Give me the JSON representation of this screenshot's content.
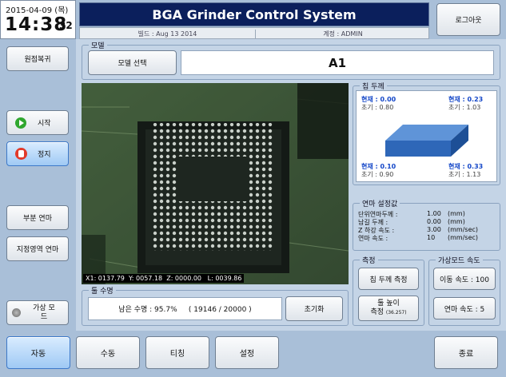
{
  "datetime": {
    "date": "2015-04-09 (목)",
    "time": "14:38",
    "seconds": "32"
  },
  "header": {
    "title": "BGA Grinder Control System",
    "build": "빌드 : Aug 13 2014",
    "account": "계정 : ADMIN"
  },
  "buttons": {
    "logout": "로그아웃",
    "home": "원점복귀",
    "start": "시작",
    "stop": "정지",
    "partial": "부분 연마",
    "area": "지정영역 연마",
    "virtual": "가상 모드",
    "model_select": "모델 선택",
    "reset": "초기화",
    "measure_thickness": "칩 두께 측정",
    "measure_height_l1": "툴 높이",
    "measure_height_l2": "측정",
    "measure_height_val": "(36.257)",
    "move_speed": "이동 속도 : 100",
    "grind_speed": "연마 속도 : 5",
    "exit": "종료"
  },
  "tabs": [
    "자동",
    "수동",
    "티칭",
    "설정"
  ],
  "model": {
    "title": "모델",
    "value": "A1"
  },
  "camera": {
    "coords": "X1: 0137.79  Y: 0057.18  Z: 0000.00   L: 0039.86"
  },
  "tool_life": {
    "title": "툴 수명",
    "text": "남은 수명 : 95.7%     ( 19146 / 20000 )"
  },
  "chip": {
    "title": "칩 두께",
    "tl_cur": "현재 : 0.00",
    "tl_init": "초기 : 0.80",
    "tr_cur": "현재 : 0.23",
    "tr_init": "초기 : 1.03",
    "bl_cur": "현재 : 0.10",
    "bl_init": "초기 : 0.90",
    "br_cur": "현재 : 0.33",
    "br_init": "초기 : 1.13"
  },
  "grind_settings": {
    "title": "연마 설정값",
    "rows": [
      {
        "label": "단위연마두께 :",
        "value": "1.00",
        "unit": "(mm)"
      },
      {
        "label": "남길 두께 :",
        "value": "0.00",
        "unit": "(mm)"
      },
      {
        "label": "Z 하강 속도 :",
        "value": "3.00",
        "unit": "(mm/sec)"
      },
      {
        "label": "연마 속도 :",
        "value": "10",
        "unit": "(mm/sec)"
      }
    ]
  },
  "measure": {
    "title": "측정"
  },
  "virtual_speed": {
    "title": "가상모드 속도"
  },
  "colors": {
    "accent_blue": "#1447c8",
    "header_bg": "#0b1f5c",
    "chip_blue": "#2e67b8"
  }
}
